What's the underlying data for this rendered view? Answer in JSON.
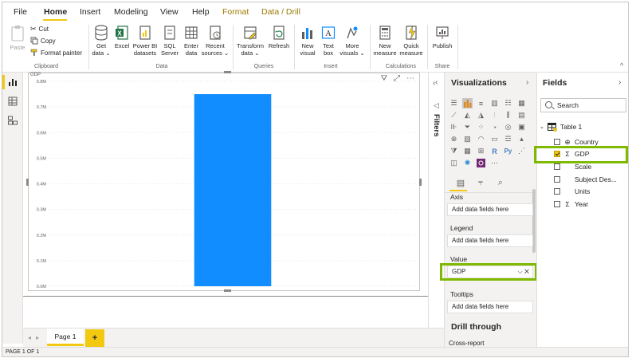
{
  "menu": {
    "tabs": [
      {
        "label": "File",
        "active": false,
        "context": false
      },
      {
        "label": "Home",
        "active": true,
        "context": false
      },
      {
        "label": "Insert",
        "active": false,
        "context": false
      },
      {
        "label": "Modeling",
        "active": false,
        "context": false
      },
      {
        "label": "View",
        "active": false,
        "context": false
      },
      {
        "label": "Help",
        "active": false,
        "context": false
      },
      {
        "label": "Format",
        "active": false,
        "context": true
      },
      {
        "label": "Data / Drill",
        "active": false,
        "context": true
      }
    ]
  },
  "ribbon": {
    "clipboard": {
      "paste": "Paste",
      "cut": "Cut",
      "copy": "Copy",
      "format_painter": "Format painter",
      "group": "Clipboard"
    },
    "data": {
      "get_data": [
        "Get",
        "data ⌄"
      ],
      "excel": "Excel",
      "power_bi": [
        "Power BI",
        "datasets"
      ],
      "sql": [
        "SQL",
        "Server"
      ],
      "enter": [
        "Enter",
        "data"
      ],
      "recent": [
        "Recent",
        "sources ⌄"
      ],
      "group": "Data"
    },
    "queries": {
      "transform": [
        "Transform",
        "data ⌄"
      ],
      "refresh": "Refresh",
      "group": "Queries"
    },
    "insert": {
      "new_visual": [
        "New",
        "visual"
      ],
      "text_box": [
        "Text",
        "box"
      ],
      "more_visuals": [
        "More",
        "visuals ⌄"
      ],
      "group": "Insert"
    },
    "calculations": {
      "new_measure": [
        "New",
        "measure"
      ],
      "quick_measure": [
        "Quick",
        "measure"
      ],
      "group": "Calculations"
    },
    "share": {
      "publish": "Publish",
      "group": "Share"
    }
  },
  "chart_data": {
    "type": "bar",
    "categories": [
      ""
    ],
    "values": [
      0.75
    ],
    "title": "",
    "ylabel": "GDP",
    "yticks": [
      "0.0M",
      "0.1M",
      "0.2M",
      "0.3M",
      "0.4M",
      "0.5M",
      "0.6M",
      "0.7M",
      "0.8M"
    ],
    "ylim": [
      0,
      0.8
    ],
    "bar_color": "#118dff",
    "grid": true
  },
  "pages": {
    "tab": "Page 1",
    "add": "+",
    "status": "PAGE 1 OF 1"
  },
  "filters": {
    "label": "Filters",
    "collapse": "‹"
  },
  "visualizations": {
    "title": "Visualizations",
    "wells": [
      {
        "label": "Axis",
        "value": "Add data fields here",
        "filled": false
      },
      {
        "label": "Legend",
        "value": "Add data fields here",
        "filled": false
      },
      {
        "label": "Value",
        "value": "GDP",
        "filled": true
      },
      {
        "label": "Tooltips",
        "value": "Add data fields here",
        "filled": false
      }
    ],
    "drill_title": "Drill through",
    "drill_sub": "Cross-report"
  },
  "fields": {
    "title": "Fields",
    "search_placeholder": "Search",
    "table": "Table 1",
    "items": [
      {
        "name": "Country",
        "type": "globe",
        "checked": false
      },
      {
        "name": "GDP",
        "type": "sigma",
        "checked": true
      },
      {
        "name": "Scale",
        "type": "",
        "checked": false
      },
      {
        "name": "Subject Des...",
        "type": "",
        "checked": false
      },
      {
        "name": "Units",
        "type": "",
        "checked": false
      },
      {
        "name": "Year",
        "type": "sigma",
        "checked": false
      }
    ]
  },
  "colors": {
    "accent": "#f2c811",
    "highlight": "#7fba00",
    "bar": "#118dff"
  }
}
